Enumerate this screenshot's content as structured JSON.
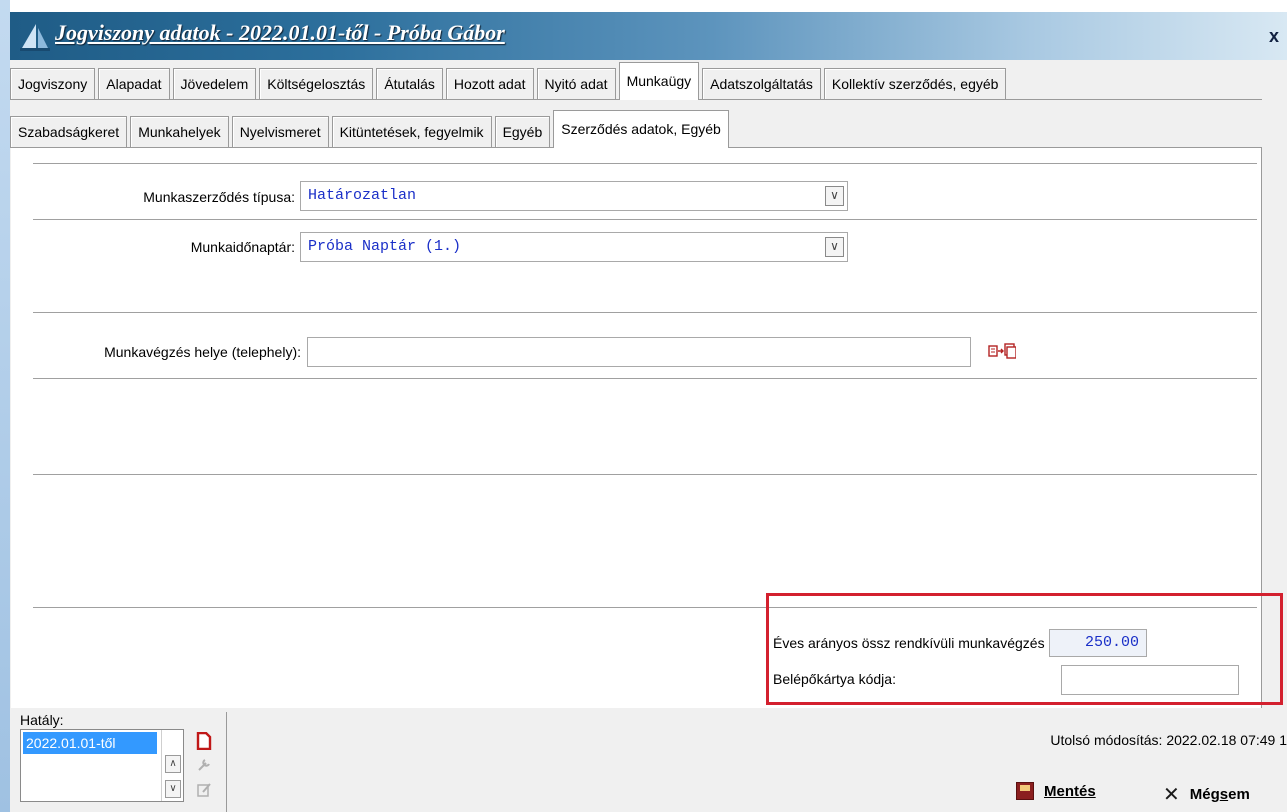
{
  "window": {
    "title": "Jogviszony adatok - 2022.01.01-től - Próba Gábor",
    "close_label": "x"
  },
  "main_tabs": [
    {
      "label": "Jogviszony",
      "active": false
    },
    {
      "label": "Alapadat",
      "active": false
    },
    {
      "label": "Jövedelem",
      "active": false
    },
    {
      "label": "Költségelosztás",
      "active": false
    },
    {
      "label": "Átutalás",
      "active": false
    },
    {
      "label": "Hozott adat",
      "active": false
    },
    {
      "label": "Nyitó adat",
      "active": false
    },
    {
      "label": "Munkaügy",
      "active": true
    },
    {
      "label": "Adatszolgáltatás",
      "active": false
    },
    {
      "label": "Kollektív szerződés, egyéb",
      "active": false
    }
  ],
  "sub_tabs": [
    {
      "label": "Szabadságkeret",
      "active": false
    },
    {
      "label": "Munkahelyek",
      "active": false
    },
    {
      "label": "Nyelvismeret",
      "active": false
    },
    {
      "label": "Kitüntetések, fegyelmik",
      "active": false
    },
    {
      "label": "Egyéb",
      "active": false
    },
    {
      "label": "Szerződés adatok, Egyéb",
      "active": true
    }
  ],
  "form": {
    "contract_type_label": "Munkaszerződés típusa:",
    "contract_type_value": "Határozatlan",
    "calendar_label": "Munkaidőnaptár:",
    "calendar_value": "Próba Naptár (1.)",
    "workplace_label": "Munkavégzés helye (telephely):",
    "workplace_value": "",
    "overtime_label": "Éves arányos össz rendkívüli munkavégzés órái",
    "overtime_value": "250.00",
    "card_label": "Belépőkártya kódja:",
    "card_value": ""
  },
  "bottom": {
    "hataly_label": "Hatály:",
    "hataly_items": [
      "2022.01.01-től"
    ],
    "last_modified": "Utolsó módosítás: 2022.02.18 07:49 1",
    "save_label": "Mentés",
    "cancel_label_pre": "Még",
    "cancel_label_ul": "s",
    "cancel_label_post": "em"
  },
  "colors": {
    "value_text": "#1a2fc8",
    "highlight_border": "#d3202e",
    "selection": "#3399ff"
  }
}
